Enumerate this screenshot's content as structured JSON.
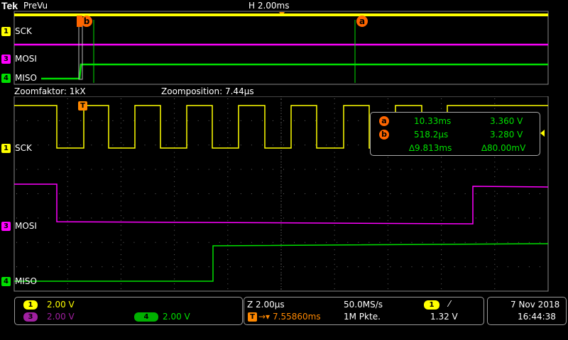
{
  "header": {
    "logo": "Tek",
    "mode": "PreVu",
    "horizontal": "H 2.00ms"
  },
  "overview": {
    "channels": [
      {
        "num": "1",
        "name": "SCK",
        "color": "#ffff00"
      },
      {
        "num": "3",
        "name": "MOSI",
        "color": "#ff00ff"
      },
      {
        "num": "4",
        "name": "MISO",
        "color": "#00e000"
      }
    ],
    "cursor_a": "a",
    "cursor_b": "b"
  },
  "zoom": {
    "factor": "Zoomfaktor: 1kX",
    "position": "Zoomposition: 7.44µs"
  },
  "main": {
    "channels": [
      {
        "num": "1",
        "name": "SCK",
        "color": "#ffff00"
      },
      {
        "num": "3",
        "name": "MOSI",
        "color": "#ff00ff"
      },
      {
        "num": "4",
        "name": "MISO",
        "color": "#00e000"
      }
    ],
    "trigger_marker": "T"
  },
  "cursor_readout": {
    "a": {
      "label": "a",
      "time": "10.33ms",
      "volt": "3.360 V"
    },
    "b": {
      "label": "b",
      "time": "518.2µs",
      "volt": "3.280 V"
    },
    "delta": {
      "time": "∆9.813ms",
      "volt": "∆80.00mV"
    }
  },
  "footer": {
    "ch1": {
      "num": "1",
      "scale": "2.00 V"
    },
    "ch3": {
      "num": "3",
      "scale": "2.00 V"
    },
    "ch4": {
      "num": "4",
      "scale": "2.00 V"
    },
    "zoom_scale": "Z 2.00µs",
    "sample_rate": "50.0MS/s",
    "trigger_pos": "7.55860ms",
    "record_length": "1M Pkte.",
    "trig_source": "1",
    "trig_slope": "⁄",
    "trig_level": "1.32 V",
    "date": "7 Nov 2018",
    "time": "16:44:38"
  },
  "colors": {
    "ch1": "#ffff00",
    "ch3": "#ff00ff",
    "ch4": "#00e000",
    "cursor": "#ff6600",
    "grid": "#555555"
  }
}
